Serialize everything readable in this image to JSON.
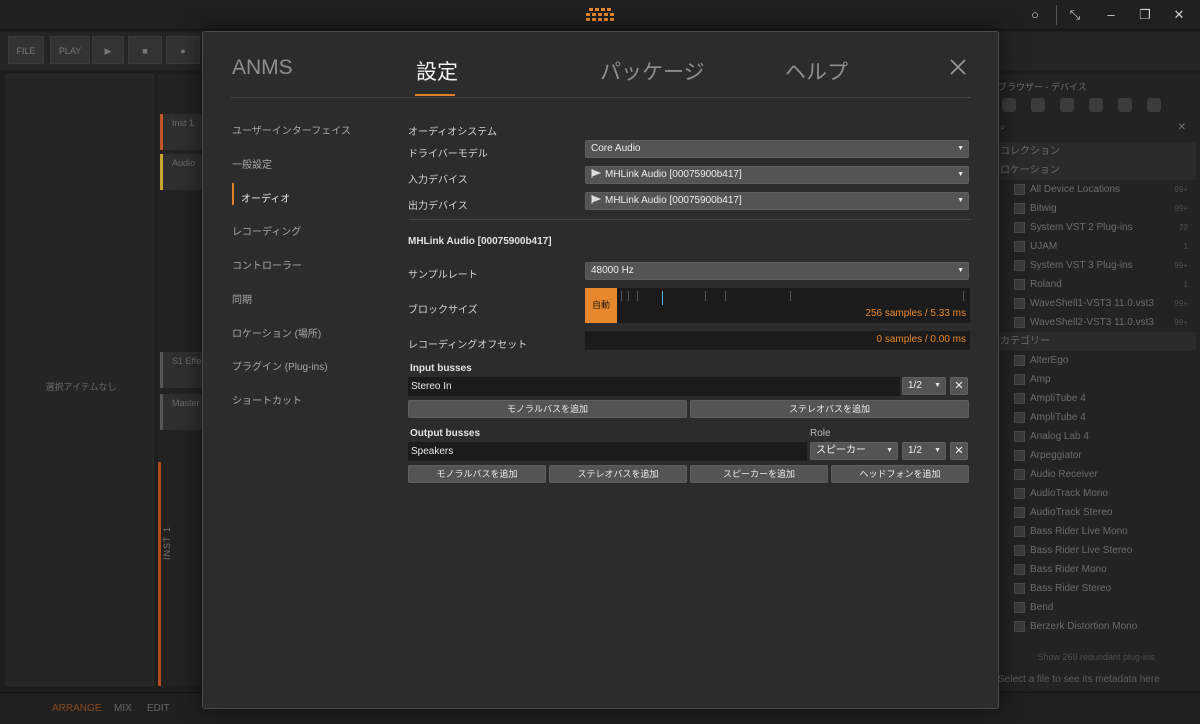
{
  "background": {
    "toolbar": [
      "FILE",
      "PLAY"
    ],
    "left_panel_empty": "選択アイテムなし",
    "tracks": [
      {
        "label": "Inst 1",
        "color": "#c0552a"
      },
      {
        "label": "Audio",
        "color": "#c9a62e"
      },
      {
        "label": "S1 Effe",
        "color": "#555555"
      },
      {
        "label": "Master",
        "color": "#555555"
      }
    ],
    "inst_vertical": "INST 1",
    "browser": {
      "title": "ブラウザー - デバイス",
      "rows": [
        {
          "label": "コレクション",
          "count": "",
          "section": true
        },
        {
          "label": "ロケーション",
          "count": "",
          "section": true
        },
        {
          "label": "All Device Locations",
          "count": "99+"
        },
        {
          "label": "Bitwig",
          "count": "99+"
        },
        {
          "label": "System VST 2 Plug-ins",
          "count": "22"
        },
        {
          "label": "UJAM",
          "count": "1"
        },
        {
          "label": "System VST 3 Plug-ins",
          "count": "99+"
        },
        {
          "label": "Roland",
          "count": "1"
        },
        {
          "label": "WaveShell1-VST3 11.0.vst3",
          "count": "99+"
        },
        {
          "label": "WaveShell2-VST3 11.0.vst3",
          "count": "99+"
        },
        {
          "label": "カテゴリー",
          "count": "",
          "section": true
        },
        {
          "label": "AlterEgo",
          "count": ""
        },
        {
          "label": "Amp",
          "count": ""
        },
        {
          "label": "AmpliTube 4",
          "count": ""
        },
        {
          "label": "AmpliTube 4",
          "count": ""
        },
        {
          "label": "Analog Lab 4",
          "count": ""
        },
        {
          "label": "Arpeggiator",
          "count": ""
        },
        {
          "label": "Audio Receiver",
          "count": ""
        },
        {
          "label": "AudioTrack Mono",
          "count": ""
        },
        {
          "label": "AudioTrack Stereo",
          "count": ""
        },
        {
          "label": "Bass Rider Live Mono",
          "count": ""
        },
        {
          "label": "Bass Rider Live Stereo",
          "count": ""
        },
        {
          "label": "Bass Rider Mono",
          "count": ""
        },
        {
          "label": "Bass Rider Stereo",
          "count": ""
        },
        {
          "label": "Bend",
          "count": ""
        },
        {
          "label": "Berzerk Distortion Mono",
          "count": ""
        }
      ],
      "more": "Show 269 redundant plug-ins",
      "footer": "Select a file to see its metadata here"
    },
    "status_tabs": [
      "ARRANGE",
      "MIX",
      "EDIT"
    ]
  },
  "dialog": {
    "tabs": [
      "ANMS",
      "設定",
      "パッケージ",
      "ヘルプ"
    ],
    "active_tab": "設定",
    "sidebar": [
      "ユーザーインターフェイス",
      "一般設定",
      "オーディオ",
      "レコーディング",
      "コントローラー",
      "同期",
      "ロケーション (場所)",
      "プラグイン (Plug-ins)",
      "ショートカット"
    ],
    "active_sidebar": "オーディオ",
    "audio": {
      "section_title": "オーディオシステム",
      "driver_label": "ドライバーモデル",
      "driver_value": "Core Audio",
      "input_label": "入力デバイス",
      "input_value": "MHLink Audio [00075900b417]",
      "output_label": "出力デバイス",
      "output_value": "MHLink Audio [00075900b417]",
      "device_title": "MHLink Audio [00075900b417]",
      "sample_rate_label": "サンプルレート",
      "sample_rate_value": "48000 Hz",
      "block_label": "ブロックサイズ",
      "block_auto": "自動",
      "block_value": "256 samples / 5.33 ms",
      "rec_offset_label": "レコーディングオフセット",
      "rec_offset_value": "0 samples / 0.00 ms"
    },
    "input_busses": {
      "title": "Input busses",
      "name": "Stereo In",
      "channels": "1/2",
      "add_mono": "モノラルバスを追加",
      "add_stereo": "ステレオバスを追加"
    },
    "output_busses": {
      "title": "Output busses",
      "role_header": "Role",
      "name": "Speakers",
      "role": "スピーカー",
      "channels": "1/2",
      "add_mono": "モノラルバスを追加",
      "add_stereo": "ステレオバスを追加",
      "add_speaker": "スピーカーを追加",
      "add_headphone": "ヘッドフォンを追加"
    },
    "accent_color": "#e07f2a"
  }
}
